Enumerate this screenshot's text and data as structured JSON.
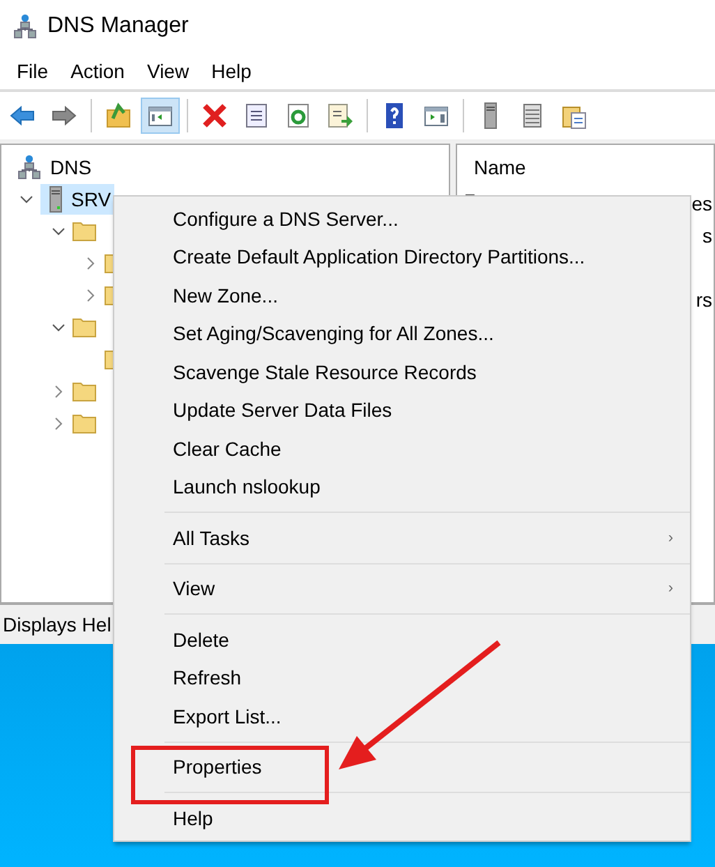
{
  "window": {
    "title": "DNS Manager"
  },
  "menu_bar": [
    "File",
    "Action",
    "View",
    "Help"
  ],
  "toolbar": [
    {
      "kind": "back",
      "pressed": false
    },
    {
      "kind": "forward",
      "pressed": false
    },
    {
      "kind": "sep"
    },
    {
      "kind": "up",
      "pressed": false
    },
    {
      "kind": "tree",
      "pressed": true
    },
    {
      "kind": "sep"
    },
    {
      "kind": "delete",
      "pressed": false
    },
    {
      "kind": "properties",
      "pressed": false
    },
    {
      "kind": "refresh",
      "pressed": false
    },
    {
      "kind": "export",
      "pressed": false
    },
    {
      "kind": "sep"
    },
    {
      "kind": "help",
      "pressed": false
    },
    {
      "kind": "pane",
      "pressed": false
    },
    {
      "kind": "sep"
    },
    {
      "kind": "server",
      "pressed": false
    },
    {
      "kind": "list",
      "pressed": false
    },
    {
      "kind": "docs",
      "pressed": false
    }
  ],
  "tree": {
    "root": {
      "label": "DNS",
      "children": [
        {
          "label": "SRV",
          "selected": true,
          "expanded": true,
          "children": [
            {
              "expanded": true,
              "expandable": true,
              "children": [
                {
                  "expanded": false,
                  "expandable": true
                },
                {
                  "expanded": false,
                  "expandable": true
                }
              ]
            },
            {
              "expanded": true,
              "expandable": true,
              "children": [
                {
                  "expandable": false
                }
              ]
            },
            {
              "expanded": false,
              "expandable": true
            },
            {
              "expanded": false,
              "expandable": true
            }
          ]
        }
      ]
    }
  },
  "list_pane": {
    "column": "Name",
    "rows": [
      {
        "name": "es",
        "icon": true
      },
      {
        "name": "s",
        "icon": false
      },
      {
        "name": "rs",
        "icon": false
      }
    ]
  },
  "status_bar": "Displays Hel",
  "context_menu": [
    {
      "kind": "item",
      "label": "Configure a DNS Server..."
    },
    {
      "kind": "item",
      "label": "Create Default Application Directory Partitions..."
    },
    {
      "kind": "item",
      "label": "New Zone..."
    },
    {
      "kind": "item",
      "label": "Set Aging/Scavenging for All Zones..."
    },
    {
      "kind": "item",
      "label": "Scavenge Stale Resource Records"
    },
    {
      "kind": "item",
      "label": "Update Server Data Files"
    },
    {
      "kind": "item",
      "label": "Clear Cache"
    },
    {
      "kind": "item",
      "label": "Launch nslookup"
    },
    {
      "kind": "separator"
    },
    {
      "kind": "submenu",
      "label": "All Tasks",
      "arrow": "›"
    },
    {
      "kind": "separator"
    },
    {
      "kind": "submenu",
      "label": "View",
      "arrow": "›"
    },
    {
      "kind": "separator"
    },
    {
      "kind": "item",
      "label": "Delete"
    },
    {
      "kind": "item",
      "label": "Refresh"
    },
    {
      "kind": "item",
      "label": "Export List..."
    },
    {
      "kind": "separator"
    },
    {
      "kind": "item",
      "label": "Properties",
      "annotated": true
    },
    {
      "kind": "separator"
    },
    {
      "kind": "item",
      "label": "Help"
    }
  ]
}
